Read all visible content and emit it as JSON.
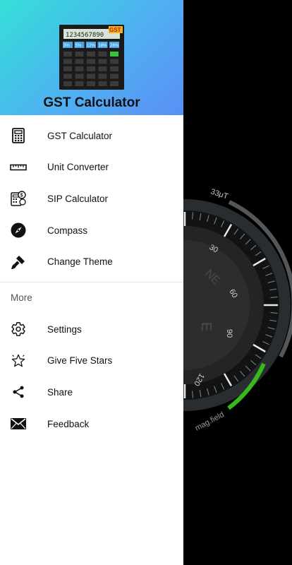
{
  "header": {
    "title": "GST Calculator",
    "logo": {
      "display": "1234567890",
      "badge": "GST",
      "rates": [
        "3%",
        "5%",
        "12%",
        "18%",
        "28%"
      ]
    }
  },
  "menu_main": [
    {
      "label": "GST Calculator",
      "icon": "calculator-icon"
    },
    {
      "label": "Unit Converter",
      "icon": "ruler-icon"
    },
    {
      "label": "SIP Calculator",
      "icon": "sip-calculator-icon"
    },
    {
      "label": "Compass",
      "icon": "compass-icon"
    },
    {
      "label": "Change Theme",
      "icon": "paint-brush-icon"
    }
  ],
  "section_more": "More",
  "menu_more": [
    {
      "label": "Settings",
      "icon": "gear-icon"
    },
    {
      "label": "Give Five Stars",
      "icon": "star-icon"
    },
    {
      "label": "Share",
      "icon": "share-icon"
    },
    {
      "label": "Feedback",
      "icon": "mail-icon"
    }
  ],
  "compass": {
    "field_label": "33μT",
    "mag_label": "mag.field",
    "tick_labels": [
      "30",
      "60",
      "90",
      "120"
    ],
    "directions": [
      "NE",
      "E"
    ]
  },
  "colors": {
    "header_start": "#34e0d8",
    "header_end": "#5a8ff5",
    "field_green": "#39b81e"
  }
}
